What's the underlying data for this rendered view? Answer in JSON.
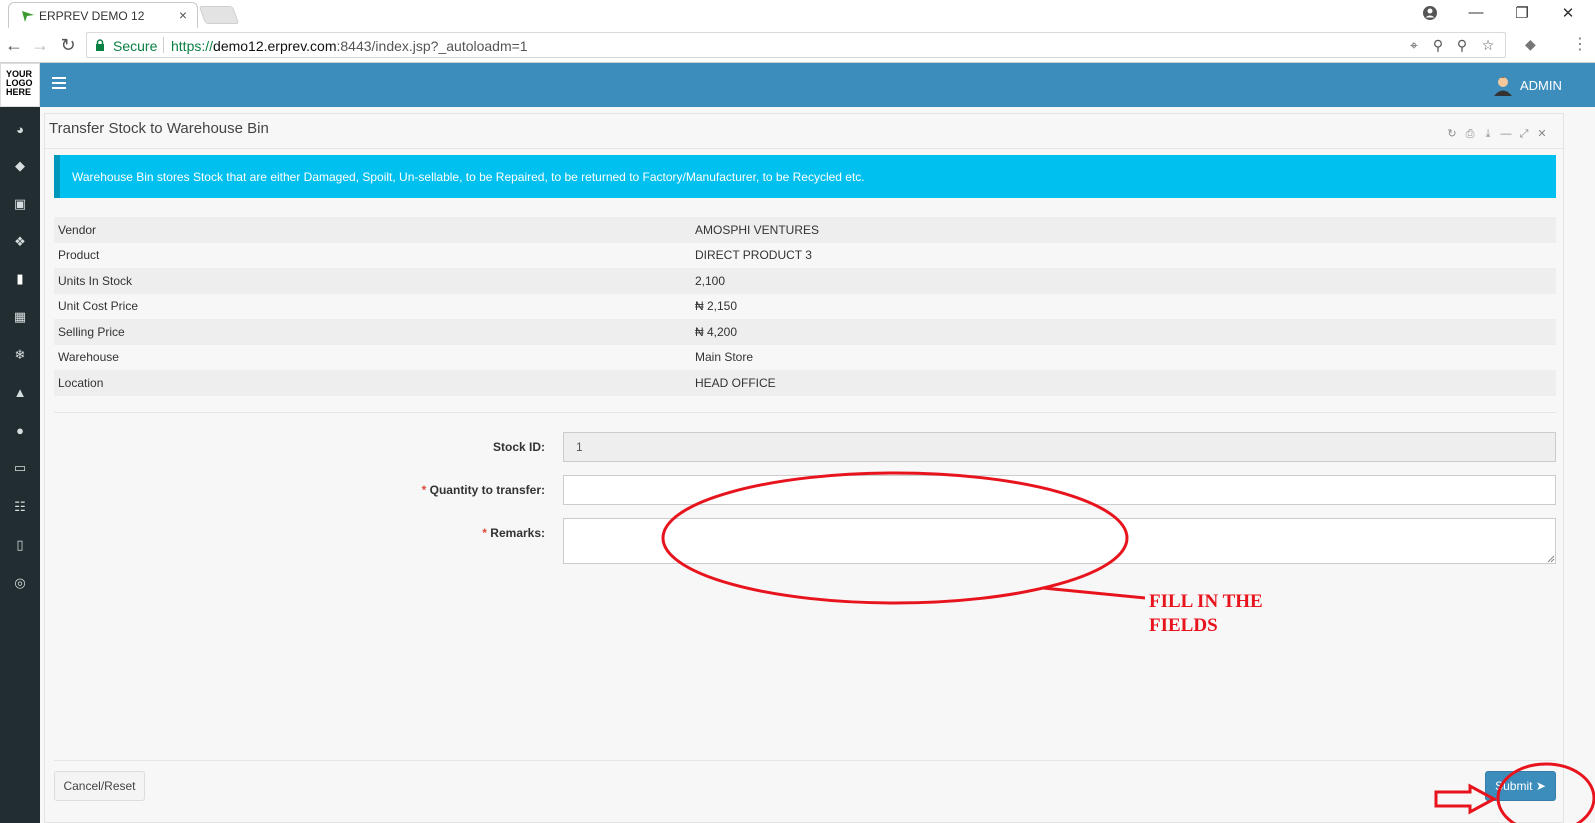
{
  "browser": {
    "tab_title": "ERPREV DEMO 12",
    "tab_close": "×",
    "secure_label": "Secure",
    "url_scheme": "https://",
    "url_host": "demo12.erprev.com",
    "url_rest": ":8443/index.jsp?_autoloadm=1",
    "colors": {
      "secure_green": "#0b8043"
    }
  },
  "sidebar": {
    "logo_text": [
      "YOUR",
      "LOGO",
      "HERE"
    ],
    "icons": [
      "dashboard-icon",
      "tag-icon",
      "money-icon",
      "cubes-icon",
      "document-icon",
      "trash-icon",
      "snowflake-icon",
      "cart-icon",
      "circle-icon",
      "desktop-icon",
      "database-icon",
      "book-icon",
      "lifebuoy-icon"
    ]
  },
  "topbar": {
    "user": "ADMIN",
    "color": "#3c8dbc"
  },
  "panel": {
    "title": "Transfer Stock to Warehouse Bin",
    "tools": [
      "refresh-icon",
      "print-icon",
      "download-icon",
      "minimize-icon",
      "expand-icon",
      "close-icon"
    ]
  },
  "alert": {
    "text": "Warehouse Bin stores Stock that are either Damaged, Spoilt, Un-sellable, to be Repaired, to be returned to Factory/Manufacturer, to be Recycled etc.",
    "color": "#00c0ef"
  },
  "details": [
    {
      "label": "Vendor",
      "value": "AMOSPHI VENTURES"
    },
    {
      "label": "Product",
      "value": "DIRECT PRODUCT 3"
    },
    {
      "label": "Units In Stock",
      "value": "2,100"
    },
    {
      "label": "Unit Cost Price",
      "value": "₦ 2,150"
    },
    {
      "label": "Selling Price",
      "value": "₦ 4,200"
    },
    {
      "label": "Warehouse",
      "value": "Main Store"
    },
    {
      "label": "Location",
      "value": "HEAD OFFICE"
    }
  ],
  "form": {
    "stock_id_label": "Stock ID:",
    "stock_id_value": "1",
    "required_mark": "*",
    "quantity_label": " Quantity to transfer:",
    "quantity_value": "",
    "remarks_label": " Remarks:",
    "remarks_value": ""
  },
  "buttons": {
    "cancel": "Cancel/Reset",
    "submit": "Submit"
  },
  "annotation": {
    "line1": "FILL IN THE",
    "line2": "FIELDS",
    "color": "#e8141d"
  }
}
